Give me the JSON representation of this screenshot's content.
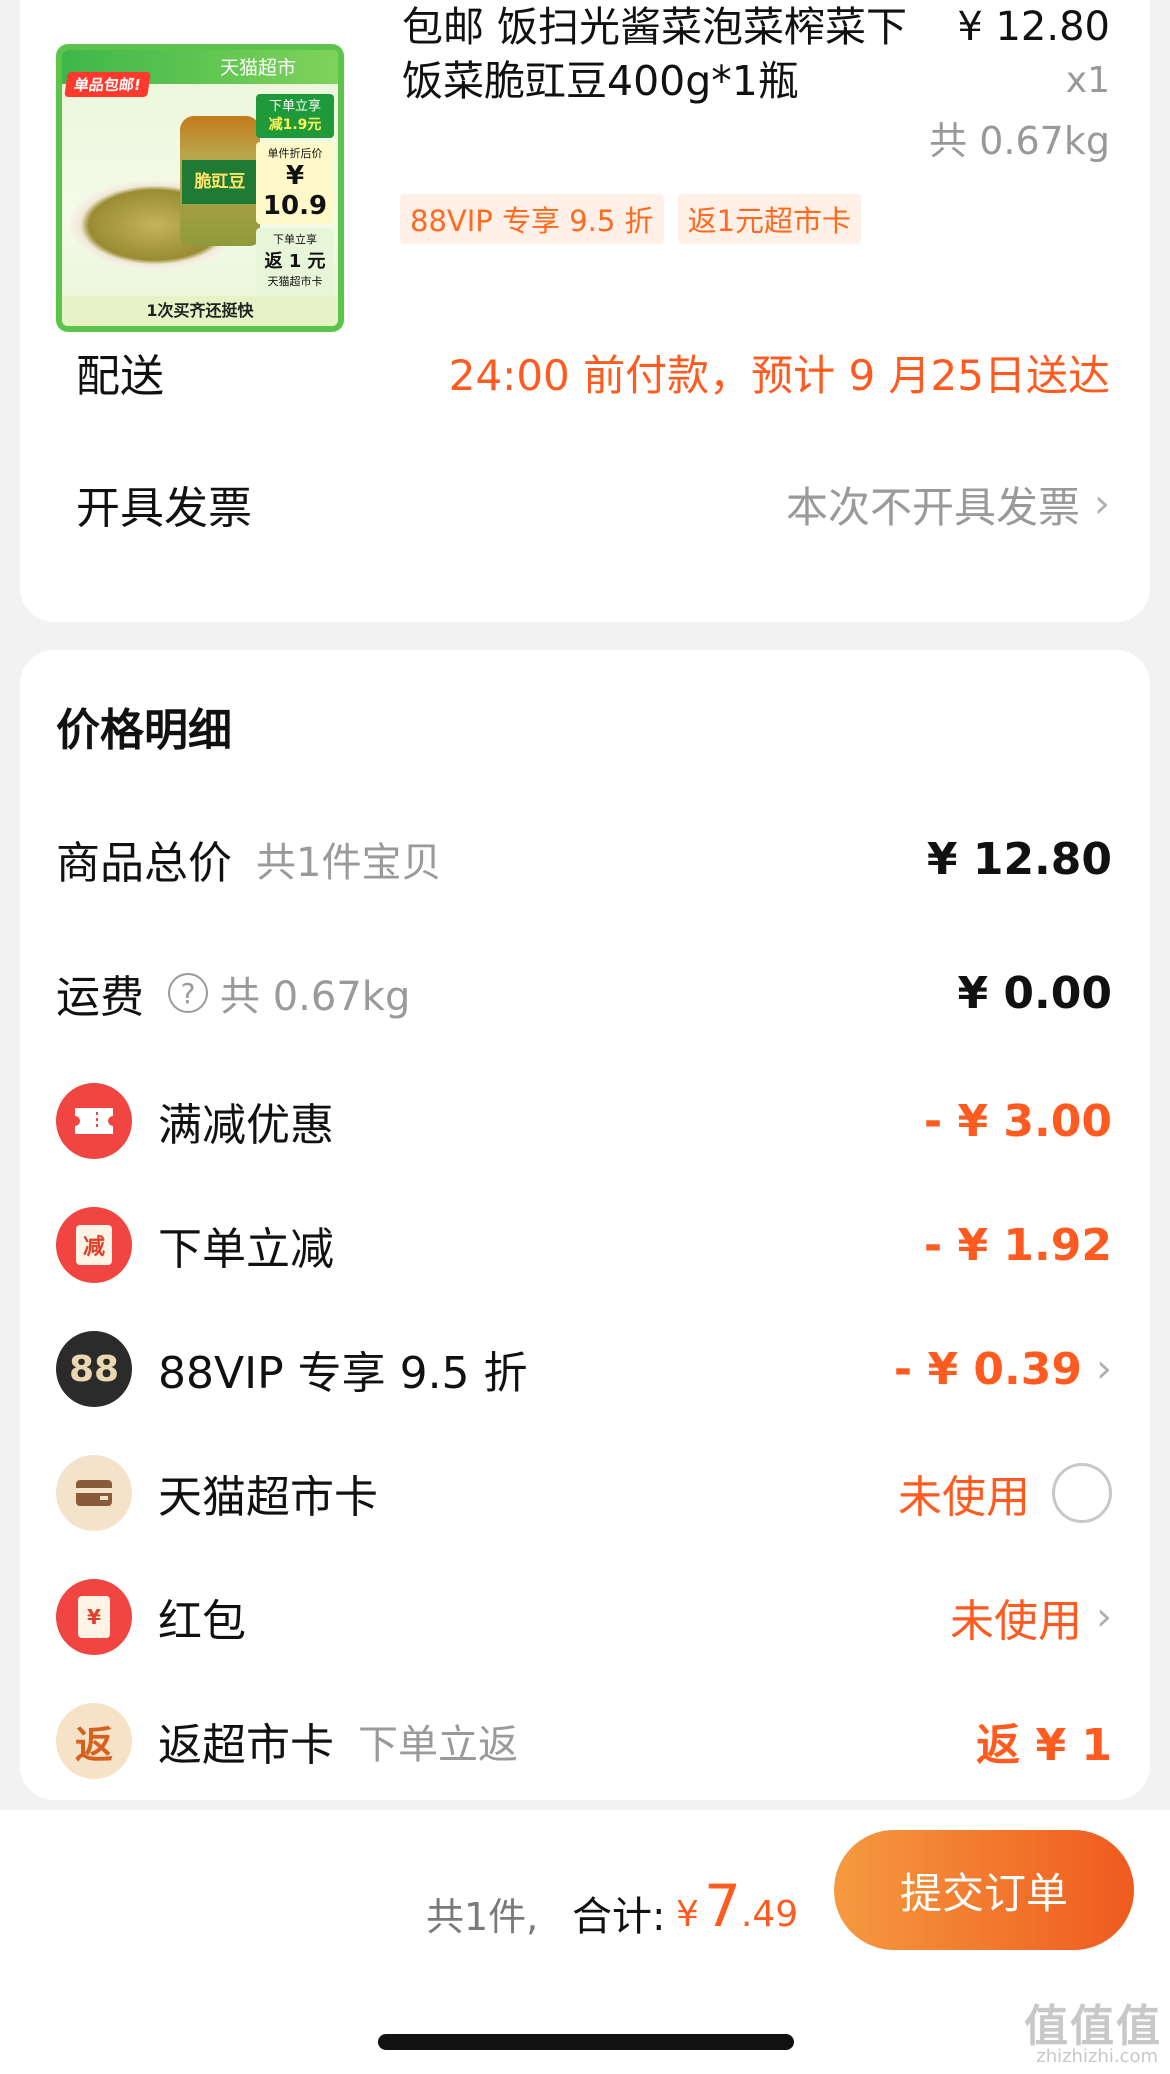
{
  "item": {
    "image": {
      "banner": "天猫超市",
      "ribbon": "单品包邮!",
      "jar_label": "脆豇豆",
      "side1_top": "下单立享",
      "side1_bottom": "减1.9元",
      "side2_top": "单件折后价",
      "side2_price": "¥ 10.9",
      "side3_top": "下单立享",
      "side3_main": "返 1 元",
      "side3_bottom": "天猫超市卡",
      "footer": "1次买齐还挺快"
    },
    "title": "包邮 饭扫光酱菜泡菜榨菜下饭菜脆豇豆400g*1瓶",
    "price": "¥ 12.80",
    "quantity": "x1",
    "weight": "共 0.67kg",
    "tags": [
      "88VIP 专享 9.5 折",
      "返1元超市卡"
    ]
  },
  "delivery": {
    "label": "配送",
    "value": "24:00 前付款，预计 9 月25日送达"
  },
  "invoice": {
    "label": "开具发票",
    "value": "本次不开具发票"
  },
  "price_detail": {
    "title": "价格明细",
    "goods_total": {
      "label": "商品总价",
      "sub": "共1件宝贝",
      "amount": "¥ 12.80"
    },
    "shipping": {
      "label": "运费",
      "sub": "共 0.67kg",
      "amount": "¥ 0.00"
    },
    "full_reduction": {
      "label": "满减优惠",
      "amount": "- ¥ 3.00",
      "icon": "ticket-icon"
    },
    "order_reduction": {
      "label": "下单立减",
      "amount": "- ¥ 1.92",
      "icon_text": "减"
    },
    "vip": {
      "label": "88VIP 专享 9.5 折",
      "amount": "- ¥ 0.39",
      "icon_text": "88"
    },
    "market_card": {
      "label": "天猫超市卡",
      "value": "未使用",
      "icon": "card-icon"
    },
    "red_packet": {
      "label": "红包",
      "value": "未使用",
      "icon_text": "¥"
    },
    "rebate": {
      "label": "返超市卡",
      "sub": "下单立返",
      "amount": "返 ¥ 1",
      "icon_text": "返"
    }
  },
  "bottom": {
    "count": "共1件,",
    "total_label": "合计:",
    "currency": "¥",
    "total_int": "7",
    "total_dec": ".49",
    "submit": "提交订单"
  },
  "watermark": {
    "text": "值值值",
    "url": "zhizhizhi.com"
  },
  "colors": {
    "accent": "#ff5a1f",
    "button_start": "#f59a3f",
    "button_end": "#ef5a1f"
  }
}
